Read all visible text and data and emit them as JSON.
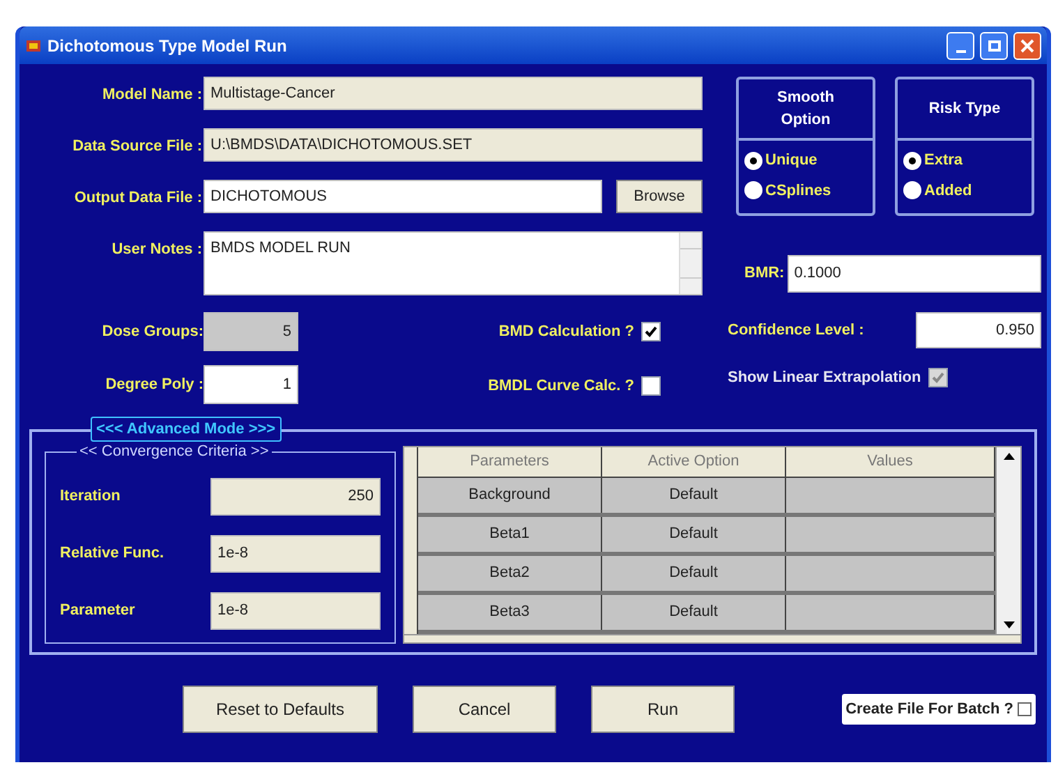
{
  "window": {
    "title": "Dichotomous Type Model Run"
  },
  "fields": [
    {
      "label": "Model Name :",
      "value": "Multistage-Cancer",
      "kind": "readonly"
    },
    {
      "label": "Data Source File :",
      "value": "U:\\BMDS\\DATA\\DICHOTOMOUS.SET",
      "kind": "readonly"
    },
    {
      "label": "Output Data File :",
      "value": "DICHOTOMOUS",
      "kind": "browse",
      "button": "Browse"
    },
    {
      "label": "User Notes :",
      "value": "BMDS MODEL RUN",
      "kind": "notes"
    }
  ],
  "option_groups": [
    {
      "title": "Smooth Option",
      "options": [
        {
          "label": "Unique",
          "selected": true
        },
        {
          "label": "CSplines",
          "selected": false
        }
      ]
    },
    {
      "title": "Risk Type",
      "options": [
        {
          "label": "Extra",
          "selected": true
        },
        {
          "label": "Added",
          "selected": false
        }
      ]
    }
  ],
  "bmr": {
    "label": "BMR:",
    "value": "0.1000"
  },
  "dose_groups": {
    "label": "Dose Groups:",
    "value": "5",
    "disabled": true
  },
  "degree_poly": {
    "label": "Degree Poly :",
    "value": "1",
    "disabled": false
  },
  "checks": [
    {
      "label": "BMD Calculation ?",
      "checked": true,
      "disabled": false
    },
    {
      "label": "BMDL Curve Calc. ?",
      "checked": false,
      "disabled": false
    }
  ],
  "confidence": {
    "label": "Confidence Level :",
    "value": "0.950"
  },
  "linear_extrapolation": {
    "label": "Show Linear Extrapolation",
    "checked": true,
    "disabled": true
  },
  "advanced": {
    "title": "<<< Advanced Mode >>>",
    "convergence": {
      "title": "<< Convergence Criteria >>",
      "fields": [
        {
          "label": "Iteration",
          "value": "250",
          "kind": "count"
        },
        {
          "label": "Relative Func.",
          "value": "1e-8",
          "kind": "tolerance"
        },
        {
          "label": "Parameter",
          "value": "1e-8",
          "kind": "tolerance"
        }
      ]
    },
    "table": {
      "columns": [
        "Parameters",
        "Active Option",
        "Values"
      ],
      "rows": [
        [
          "Background",
          "Default",
          ""
        ],
        [
          "Beta1",
          "Default",
          ""
        ],
        [
          "Beta2",
          "Default",
          ""
        ],
        [
          "Beta3",
          "Default",
          ""
        ]
      ]
    }
  },
  "buttons": [
    "Reset to Defaults",
    "Cancel",
    "Run"
  ],
  "batch": {
    "label": "Create File For Batch ?",
    "checked": false
  }
}
